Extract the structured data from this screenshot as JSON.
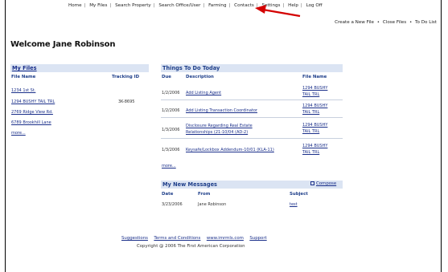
{
  "topnav": {
    "home": "Home",
    "my_files": "My Files",
    "search_property": "Search Property",
    "search_office_user": "Search Office/User",
    "farming": "Farming",
    "contacts": "Contacts",
    "settings": "Settings",
    "help": "Help",
    "log_off": "Log Off"
  },
  "subnav": {
    "create_file": "Create a New File",
    "close_files": "Close Files",
    "todo_list": "To Do List",
    "bullet": "•"
  },
  "welcome": "Welcome Jane Robinson",
  "my_files": {
    "title": "My Files",
    "col_file": "File Name",
    "col_tracking": "Tracking ID",
    "rows": [
      {
        "name": "1234 1st St.",
        "tracking": ""
      },
      {
        "name": "1294 BUSHY TAIL TRL",
        "tracking": "3K-8695"
      },
      {
        "name": "2769 Ridge View Rd.",
        "tracking": ""
      },
      {
        "name": "6789 Brookhill Lane",
        "tracking": ""
      }
    ],
    "more": "more..."
  },
  "todo": {
    "title": "Things To Do Today",
    "col_due": "Due",
    "col_desc": "Description",
    "col_file": "File Name",
    "rows": [
      {
        "due": "1/2/2006",
        "desc1": "Add Listing Agent",
        "desc2": "",
        "file1": "1294 BUSHY",
        "file2": "TAIL TRL"
      },
      {
        "due": "1/2/2006",
        "desc1": "Add Listing Transaction Coordinator",
        "desc2": "",
        "file1": "1294 BUSHY",
        "file2": "TAIL TRL"
      },
      {
        "due": "1/3/2006",
        "desc1": "Disclosure Regarding Real Estate",
        "desc2": "Relationships (21-10/04 (AD-2)",
        "file1": "1294 BUSHY",
        "file2": "TAIL TRL"
      },
      {
        "due": "1/3/2006",
        "desc1": "Keysafe/Lockbox Addendum-10/01 (KLA-11)",
        "desc2": "",
        "file1": "1294 BUSHY",
        "file2": "TAIL TRL"
      }
    ],
    "more": "more..."
  },
  "messages": {
    "title": "My New Messages",
    "compose": "Compose",
    "col_date": "Date",
    "col_from": "From",
    "col_subject": "Subject",
    "rows": [
      {
        "date": "3/23/2006",
        "from": "Jane Robinson",
        "subject": "test"
      }
    ]
  },
  "footer": {
    "suggestions": "Suggestions",
    "terms": "Terms and Conditions",
    "site": "www.imrmls.com",
    "support": "Support",
    "copyright": "Copyright @ 2006 The First American Corporation"
  },
  "colors": {
    "header_bg": "#dbe4f3",
    "header_text": "#1f3f8a",
    "link": "#1a2f8a",
    "arrow": "#d40000"
  }
}
